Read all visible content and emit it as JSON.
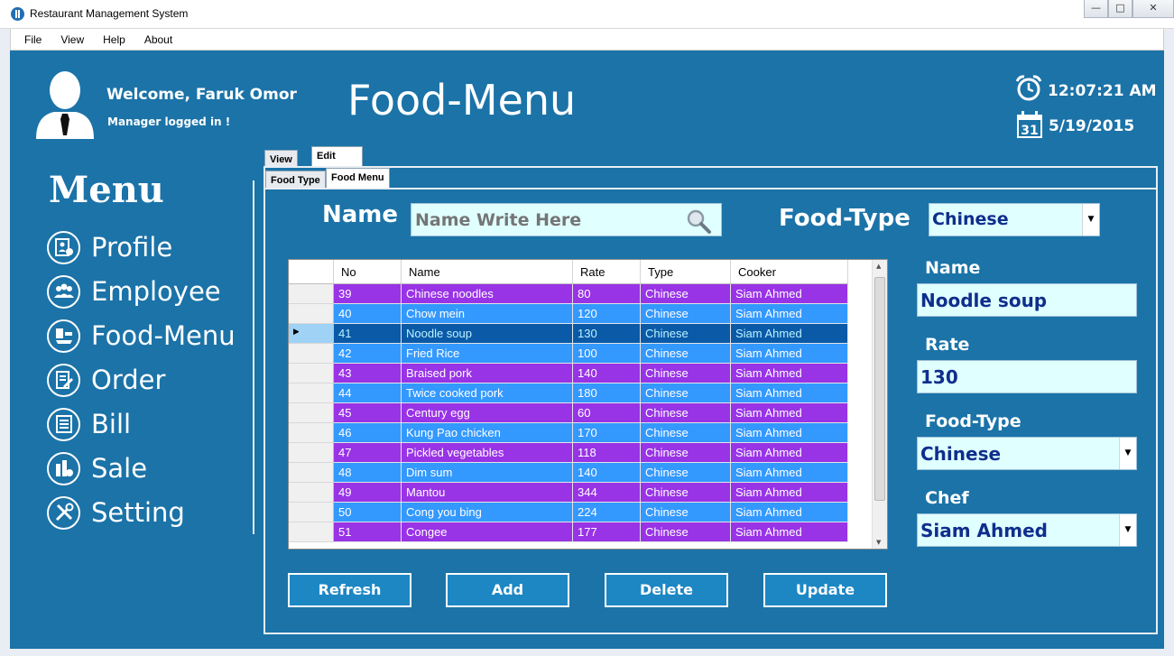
{
  "window": {
    "title": "Restaurant Management System"
  },
  "menubar": {
    "items": [
      "File",
      "View",
      "Help",
      "About"
    ]
  },
  "user": {
    "welcome": "Welcome, Faruk Omor",
    "role": "Manager logged in !"
  },
  "page_title": "Food-Menu",
  "clock": {
    "time": "12:07:21 AM",
    "date": "5/19/2015",
    "calendar_day": "31"
  },
  "sidebar": {
    "heading": "Menu",
    "items": [
      {
        "label": "Profile",
        "icon": "profile-icon"
      },
      {
        "label": "Employee",
        "icon": "employee-icon"
      },
      {
        "label": "Food-Menu",
        "icon": "food-menu-icon"
      },
      {
        "label": "Order",
        "icon": "order-icon"
      },
      {
        "label": "Bill",
        "icon": "bill-icon"
      },
      {
        "label": "Sale",
        "icon": "sale-icon"
      },
      {
        "label": "Setting",
        "icon": "setting-icon"
      }
    ]
  },
  "tabs": {
    "outer": [
      "View",
      "Edit"
    ],
    "outer_active": "Edit",
    "inner": [
      "Food Type",
      "Food Menu"
    ],
    "inner_active": "Food Menu"
  },
  "search": {
    "label": "Name",
    "placeholder": "Name Write Here",
    "foodtype_label": "Food-Type",
    "foodtype_value": "Chinese"
  },
  "colors": {
    "row_purple": "#9933e6",
    "row_blue": "#3399ff",
    "row_selected": "#0a5aa8",
    "background": "#1b73a8"
  },
  "grid": {
    "columns": [
      "No",
      "Name",
      "Rate",
      "Type",
      "Cooker"
    ],
    "rows": [
      {
        "no": "39",
        "name": "Chinese noodles",
        "rate": "80",
        "type": "Chinese",
        "cooker": "Siam Ahmed"
      },
      {
        "no": "40",
        "name": "Chow mein",
        "rate": "120",
        "type": "Chinese",
        "cooker": "Siam Ahmed"
      },
      {
        "no": "41",
        "name": "Noodle soup",
        "rate": "130",
        "type": "Chinese",
        "cooker": "Siam Ahmed"
      },
      {
        "no": "42",
        "name": "Fried Rice",
        "rate": "100",
        "type": "Chinese",
        "cooker": "Siam Ahmed"
      },
      {
        "no": "43",
        "name": "Braised pork",
        "rate": "140",
        "type": "Chinese",
        "cooker": "Siam Ahmed"
      },
      {
        "no": "44",
        "name": "Twice cooked pork",
        "rate": "180",
        "type": "Chinese",
        "cooker": "Siam Ahmed"
      },
      {
        "no": "45",
        "name": "Century egg",
        "rate": "60",
        "type": "Chinese",
        "cooker": "Siam Ahmed"
      },
      {
        "no": "46",
        "name": "Kung Pao chicken",
        "rate": "170",
        "type": "Chinese",
        "cooker": "Siam Ahmed"
      },
      {
        "no": "47",
        "name": "Pickled vegetables",
        "rate": "118",
        "type": "Chinese",
        "cooker": "Siam Ahmed"
      },
      {
        "no": "48",
        "name": "Dim sum",
        "rate": "140",
        "type": "Chinese",
        "cooker": "Siam Ahmed"
      },
      {
        "no": "49",
        "name": "Mantou",
        "rate": "344",
        "type": "Chinese",
        "cooker": "Siam Ahmed"
      },
      {
        "no": "50",
        "name": "Cong you bing",
        "rate": "224",
        "type": "Chinese",
        "cooker": "Siam Ahmed"
      },
      {
        "no": "51",
        "name": "Congee",
        "rate": "177",
        "type": "Chinese",
        "cooker": "Siam Ahmed"
      }
    ],
    "selected_index": 2
  },
  "form": {
    "name_label": "Name",
    "name_value": "Noodle soup",
    "rate_label": "Rate",
    "rate_value": "130",
    "foodtype_label": "Food-Type",
    "foodtype_value": "Chinese",
    "chef_label": "Chef",
    "chef_value": "Siam Ahmed"
  },
  "buttons": {
    "refresh": "Refresh",
    "add": "Add",
    "delete": "Delete",
    "update": "Update"
  }
}
